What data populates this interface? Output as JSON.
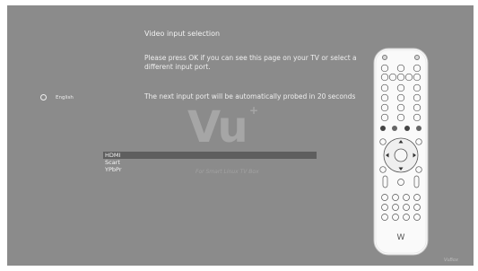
{
  "screen": {
    "title": "Video input selection",
    "instruction": "Please press OK if you can see this page on your TV or select a different input port.",
    "autoprobe": "The next input port will be automatically probed in 20 seconds"
  },
  "language": {
    "label": "English"
  },
  "ports": [
    {
      "label": "HDMI",
      "selected": true
    },
    {
      "label": "Scart",
      "selected": false
    },
    {
      "label": "YPbPr",
      "selected": false
    }
  ],
  "watermark": {
    "brand": "Vu",
    "plus": "+",
    "tagline": "For Smart Linux TV Box"
  },
  "footer": {
    "logo_text": "VuBox"
  },
  "remote": {
    "brand_mark": "W"
  },
  "colors": {
    "background": "#8b8b8b",
    "selection_bar": "#5e5e5e",
    "text": "#f0f0f0"
  }
}
